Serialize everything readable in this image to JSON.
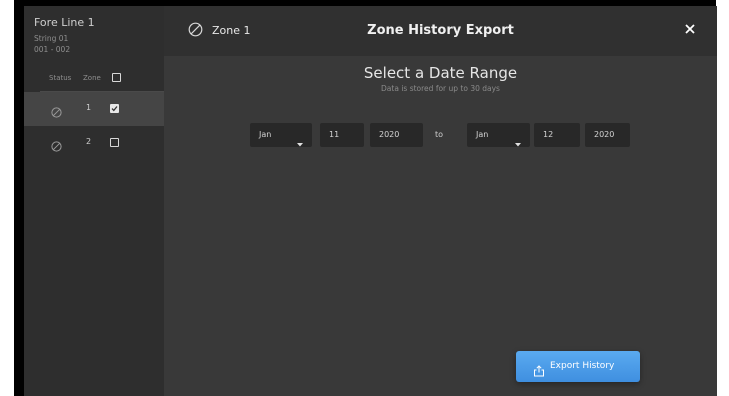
{
  "sidebar": {
    "title": "Fore Line 1",
    "string": "String 01",
    "range": "001 - 002",
    "col_status": "Status",
    "col_zone": "Zone",
    "zones": [
      {
        "zone": "1",
        "checked": true,
        "selected": true
      },
      {
        "zone": "2",
        "checked": false,
        "selected": false
      }
    ]
  },
  "header": {
    "zone_label": "Zone 1",
    "title": "Zone History Export"
  },
  "main": {
    "heading": "Select a Date Range",
    "subheading": "Data is stored for up to 30 days",
    "from": {
      "month": "Jan",
      "day": "11",
      "year": "2020"
    },
    "to_label": "to",
    "to": {
      "month": "Jan",
      "day": "12",
      "year": "2020"
    },
    "export_label": "Export History"
  },
  "colors": {
    "accent": "#4a9ae8",
    "panel": "#393939",
    "sidebar": "#2e2e2e"
  }
}
